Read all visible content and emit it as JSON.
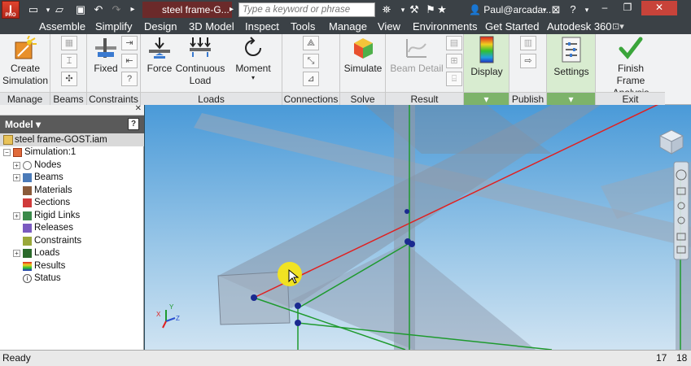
{
  "title_bar": {
    "app_logo": "I",
    "app_logo_sub": "PRO",
    "document_tab": "steel frame-G...",
    "search_placeholder": "Type a keyword or phrase",
    "user": "Paul@arcada...",
    "win_minimize": "–",
    "win_restore": "❐",
    "win_close": "✕",
    "app_minimize": "–",
    "app_restore": "❐",
    "app_close": "✕"
  },
  "ribbon_tabs": [
    "Assemble",
    "Simplify",
    "Design",
    "3D Model",
    "Inspect",
    "Tools",
    "Manage",
    "View",
    "Environments",
    "Get Started",
    "Autodesk 360"
  ],
  "ribbon": {
    "create_simulation_l1": "Create",
    "create_simulation_l2": "Simulation",
    "fixed": "Fixed",
    "force": "Force",
    "continuous_load_l1": "Continuous",
    "continuous_load_l2": "Load",
    "moment": "Moment",
    "simulate": "Simulate",
    "beam_detail": "Beam Detail",
    "display": "Display",
    "settings": "Settings",
    "finish_l1": "Finish",
    "finish_l2": "Frame Analysis",
    "panels": {
      "manage": "Manage",
      "beams": "Beams",
      "constraints": "Constraints",
      "loads": "Loads",
      "connections": "Connections",
      "solve": "Solve",
      "result": "Result",
      "publish": "Publish",
      "exit": "Exit"
    },
    "dropdown_glyph": "▾"
  },
  "browser": {
    "close_glyph": "✕",
    "header": "Model ▾",
    "help": "?",
    "root": "steel frame-GOST.iam",
    "simulation": "Simulation:1",
    "items": [
      "Nodes",
      "Beams",
      "Materials",
      "Sections",
      "Rigid Links",
      "Releases",
      "Constraints",
      "Loads",
      "Results",
      "Status"
    ]
  },
  "viewport": {
    "triad_x": "X",
    "triad_y": "Y",
    "triad_z": "Z"
  },
  "status_bar": {
    "text": "Ready",
    "count_a": "17",
    "count_b": "18"
  },
  "colors": {
    "title_bar": "#3b4146",
    "ribbon_bg": "#f1f2f3",
    "green_panel": "#7db36a",
    "axis_red": "#e02020",
    "axis_green": "#1e9a2e",
    "node": "#1a2a90",
    "cursor_highlight": "#f5e61a"
  }
}
